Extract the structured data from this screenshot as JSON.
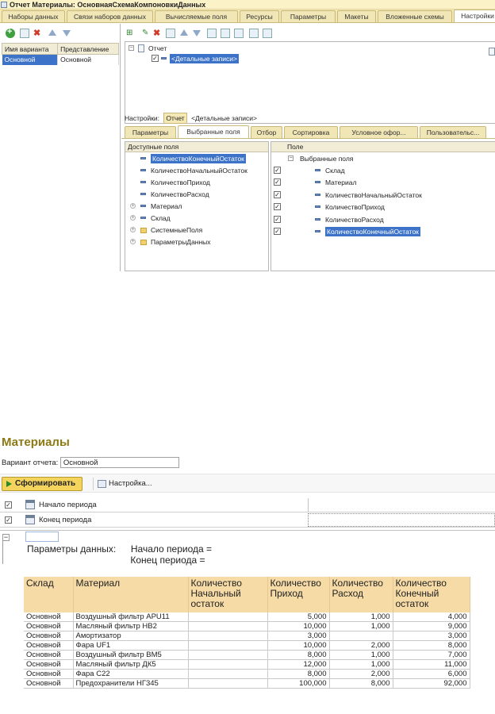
{
  "window": {
    "title": "Отчет Материалы: ОсновнаяСхемаКомпоновкиДанных",
    "tabs": [
      {
        "label": "Наборы данных",
        "active": false
      },
      {
        "label": "Связи наборов данных",
        "active": false
      },
      {
        "label": "Вычисляемые поля",
        "active": false
      },
      {
        "label": "Ресурсы",
        "active": false
      },
      {
        "label": "Параметры",
        "active": false
      },
      {
        "label": "Макеты",
        "active": false
      },
      {
        "label": "Вложенные схемы",
        "active": false
      },
      {
        "label": "Настройки",
        "active": true
      }
    ]
  },
  "variants": {
    "header_name": "Имя варианта",
    "header_view": "Представление",
    "rows": [
      {
        "name": "Основной",
        "view": "Основной",
        "selected": true
      }
    ]
  },
  "structure": {
    "root": "Отчет",
    "child": "<Детальные записи>"
  },
  "settings_line": {
    "label": "Настройки:",
    "tab": "Отчет",
    "current": "<Детальные записи>"
  },
  "settings_tabs": [
    {
      "label": "Параметры",
      "active": false
    },
    {
      "label": "Выбранные поля",
      "active": true
    },
    {
      "label": "Отбор",
      "active": false
    },
    {
      "label": "Сортировка",
      "active": false
    },
    {
      "label": "Условное офор...",
      "active": false
    },
    {
      "label": "Пользовательс...",
      "active": false
    }
  ],
  "available_fields": {
    "header": "Доступные поля",
    "items": [
      {
        "label": "КоличествоКонечныйОстаток",
        "kind": "field",
        "selected": true
      },
      {
        "label": "КоличествоНачальныйОстаток",
        "kind": "field",
        "selected": false
      },
      {
        "label": "КоличествоПриход",
        "kind": "field",
        "selected": false
      },
      {
        "label": "КоличествоРасход",
        "kind": "field",
        "selected": false
      },
      {
        "label": "Материал",
        "kind": "expandable-field",
        "selected": false
      },
      {
        "label": "Склад",
        "kind": "expandable-field",
        "selected": false
      },
      {
        "label": "СистемныеПоля",
        "kind": "folder",
        "selected": false
      },
      {
        "label": "ПараметрыДанных",
        "kind": "folder",
        "selected": false
      }
    ]
  },
  "selected_fields": {
    "header": "Поле",
    "group": "Выбранные поля",
    "items": [
      {
        "label": "Склад",
        "checked": true,
        "selected": false
      },
      {
        "label": "Материал",
        "checked": true,
        "selected": false
      },
      {
        "label": "КоличествоНачальныйОстаток",
        "checked": true,
        "selected": false
      },
      {
        "label": "КоличествоПриход",
        "checked": true,
        "selected": false
      },
      {
        "label": "КоличествоРасход",
        "checked": true,
        "selected": false
      },
      {
        "label": "КоличествоКонечныйОстаток",
        "checked": true,
        "selected": true
      }
    ]
  },
  "report": {
    "title": "Материалы",
    "variant_label": "Вариант отчета:",
    "variant_value": "Основной",
    "generate_button": "Сформировать",
    "settings_button": "Настройка...",
    "params": [
      {
        "label": "Начало периода",
        "checked": true
      },
      {
        "label": "Конец периода",
        "checked": true
      }
    ],
    "data_params_label": "Параметры данных:",
    "data_param_start": "Начало периода =",
    "data_param_end": "Конец периода =",
    "columns": [
      "Склад",
      "Материал",
      "Количество Начальный остаток",
      "Количество Приход",
      "Количество Расход",
      "Количество Конечный остаток"
    ],
    "rows": [
      [
        "Основной",
        "Воздушный фильтр APU11",
        "",
        "5,000",
        "1,000",
        "4,000"
      ],
      [
        "Основной",
        "Масляный фильтр НВ2",
        "",
        "10,000",
        "1,000",
        "9,000"
      ],
      [
        "Основной",
        "Амортизатор",
        "",
        "3,000",
        "",
        "3,000"
      ],
      [
        "Основной",
        "Фара UF1",
        "",
        "10,000",
        "2,000",
        "8,000"
      ],
      [
        "Основной",
        "Воздушный фильтр ВМ5",
        "",
        "8,000",
        "1,000",
        "7,000"
      ],
      [
        "Основной",
        "Масляный фильтр ДК5",
        "",
        "12,000",
        "1,000",
        "11,000"
      ],
      [
        "Основной",
        "Фара С22",
        "",
        "8,000",
        "2,000",
        "6,000"
      ],
      [
        "Основной",
        "Предохранители НГ345",
        "",
        "100,000",
        "8,000",
        "92,000"
      ]
    ]
  },
  "colors": {
    "accent_selection": "#3c73c8",
    "tab_bar": "#f4e8b4",
    "report_title": "#8b7a14",
    "table_header": "#f6dba6",
    "generate_button": "#f5d45e"
  }
}
